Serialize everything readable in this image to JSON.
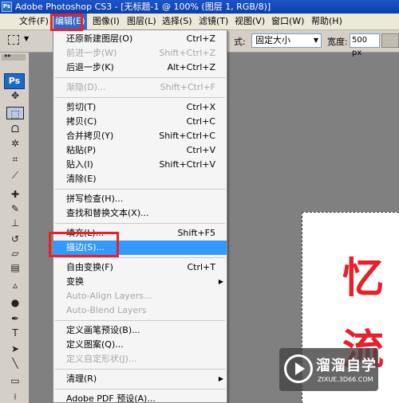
{
  "titlebar": {
    "icon": "ps-app-icon",
    "icon_text": "Ps",
    "title": "Adobe Photoshop CS3 - [无标题-1 @ 100% (图层 1, RGB/8)]"
  },
  "menubar": {
    "items": [
      {
        "label": "文件(F)"
      },
      {
        "label": "编辑(E)",
        "active": true
      },
      {
        "label": "图像(I)"
      },
      {
        "label": "图层(L)"
      },
      {
        "label": "选择(S)"
      },
      {
        "label": "滤镜(T)"
      },
      {
        "label": "视图(V)"
      },
      {
        "label": "窗口(W)"
      },
      {
        "label": "帮助(H)"
      }
    ]
  },
  "options": {
    "style_label": "式:",
    "style_value": "固定大小",
    "width_label": "宽度:",
    "width_value": "500 px"
  },
  "tools": {
    "logo": "Ps",
    "items": [
      {
        "name": "move-tool-icon",
        "glyph": "✥"
      },
      {
        "name": "marquee-tool-icon",
        "glyph": "⬚",
        "selected": true
      },
      {
        "name": "lasso-tool-icon",
        "glyph": "ᗝ"
      },
      {
        "name": "magic-wand-tool-icon",
        "glyph": "✲"
      },
      {
        "name": "crop-tool-icon",
        "glyph": "⌗"
      },
      {
        "name": "slice-tool-icon",
        "glyph": "⟋"
      },
      {
        "name": "healing-brush-tool-icon",
        "glyph": "✚"
      },
      {
        "name": "brush-tool-icon",
        "glyph": "✎"
      },
      {
        "name": "clone-stamp-tool-icon",
        "glyph": "⊥"
      },
      {
        "name": "history-brush-tool-icon",
        "glyph": "↺"
      },
      {
        "name": "eraser-tool-icon",
        "glyph": "▱"
      },
      {
        "name": "gradient-tool-icon",
        "glyph": "▤"
      },
      {
        "name": "blur-tool-icon",
        "glyph": "▵"
      },
      {
        "name": "dodge-tool-icon",
        "glyph": "●"
      },
      {
        "name": "pen-tool-icon",
        "glyph": "✒"
      },
      {
        "name": "type-tool-icon",
        "glyph": "T"
      },
      {
        "name": "path-selection-tool-icon",
        "glyph": "➤"
      },
      {
        "name": "line-tool-icon",
        "glyph": "╲"
      },
      {
        "name": "notes-tool-icon",
        "glyph": "▭"
      },
      {
        "name": "eyedropper-tool-icon",
        "glyph": "⟊"
      }
    ]
  },
  "edit_menu": {
    "items": [
      {
        "label": "还原新建图层(O)",
        "shortcut": "Ctrl+Z"
      },
      {
        "label": "前进一步(W)",
        "shortcut": "Shift+Ctrl+Z",
        "disabled": true
      },
      {
        "label": "后退一步(K)",
        "shortcut": "Alt+Ctrl+Z"
      },
      {
        "sep": true
      },
      {
        "label": "渐隐(D)...",
        "shortcut": "Shift+Ctrl+F",
        "disabled": true
      },
      {
        "sep": true
      },
      {
        "label": "剪切(T)",
        "shortcut": "Ctrl+X"
      },
      {
        "label": "拷贝(C)",
        "shortcut": "Ctrl+C"
      },
      {
        "label": "合并拷贝(Y)",
        "shortcut": "Shift+Ctrl+C"
      },
      {
        "label": "粘贴(P)",
        "shortcut": "Ctrl+V"
      },
      {
        "label": "贴入(I)",
        "shortcut": "Shift+Ctrl+V"
      },
      {
        "label": "清除(E)",
        "shortcut": ""
      },
      {
        "sep": true
      },
      {
        "label": "拼写检查(H)...",
        "shortcut": ""
      },
      {
        "label": "查找和替换文本(X)...",
        "shortcut": ""
      },
      {
        "sep": true
      },
      {
        "label": "填充(L)...",
        "shortcut": "Shift+F5"
      },
      {
        "label": "描边(S)...",
        "shortcut": "",
        "highlighted": true
      },
      {
        "sep": true
      },
      {
        "label": "自由变换(F)",
        "shortcut": "Ctrl+T"
      },
      {
        "label": "变换",
        "shortcut": "",
        "submenu": true
      },
      {
        "label": "Auto-Align Layers...",
        "shortcut": "",
        "disabled": true
      },
      {
        "label": "Auto-Blend Layers",
        "shortcut": "",
        "disabled": true
      },
      {
        "sep": true
      },
      {
        "label": "定义画笔预设(B)...",
        "shortcut": ""
      },
      {
        "label": "定义图案(Q)...",
        "shortcut": ""
      },
      {
        "label": "定义自定形状(J)...",
        "shortcut": "",
        "disabled": true
      },
      {
        "sep": true
      },
      {
        "label": "清理(R)",
        "shortcut": "",
        "submenu": true
      },
      {
        "sep": true
      },
      {
        "label": "Adobe PDF 预设(A)...",
        "shortcut": ""
      }
    ]
  },
  "canvas": {
    "chars": [
      "忆",
      "流"
    ],
    "color": "#e8202a"
  },
  "watermark": {
    "brand": "溜溜自学",
    "url": "ZIXUE.3D66.COM"
  }
}
